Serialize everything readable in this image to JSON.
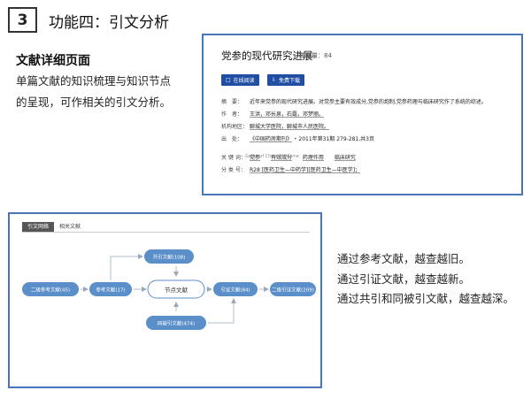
{
  "header": {
    "number": "3",
    "title": "功能四：引文分析"
  },
  "left": {
    "heading": "文献详细页面",
    "description": "单篇文献的知识梳理与知识节点的呈现，可作相关的引文分析。"
  },
  "detail": {
    "title": "党参的现代研究进展",
    "cited_label": "被引量：84",
    "buttons": {
      "read": "在线阅读",
      "download": "免费下载"
    },
    "rows": {
      "abstract_key": "摘　要：",
      "abstract": "近年来党参的现代研究进展。对党参主要有效成分,党参的炮制,党参药理与临床研究作了系统的综述。",
      "authors_key": "作　者：",
      "authors": "王洪，邓长泉，石磊，邓梦丽。",
      "org_key": "机构地区：",
      "org": "聊城大学医院，聊城市人民医院。",
      "source_key": "出　处：",
      "source_journal": "《中国药房期刊》",
      "source_detail": "2011年第31期 279-281,共3页",
      "source_en": "Guide of China Medicine",
      "keywords_key": "关 键 词：",
      "keywords": [
        "党参",
        "有效成分",
        "药理作用",
        "临床研究"
      ],
      "class_key": "分 类 号：",
      "class_value": "R28 [医药卫生—中药学][医药卫生—中医学]；"
    }
  },
  "network": {
    "tabs": [
      "引文网络",
      "相关文献"
    ],
    "nodes": {
      "second_ref": "二级参考文献(45)",
      "ref": "参考文献(17)",
      "center": "节点文献",
      "cite": "引证文献(84)",
      "second_cite": "二级引证文献(209)",
      "co_cite": "共引文献(108)",
      "co_cited": "同被引文献(474)"
    }
  },
  "right_notes": [
    "通过参考文献，越查越旧。",
    "通过引证文献，越查越新。",
    "通过共引和同被引文献，越查越深。"
  ],
  "colors": {
    "accent": "#4a76b8",
    "node": "#5b8fc9",
    "button": "#1f4ea3"
  }
}
